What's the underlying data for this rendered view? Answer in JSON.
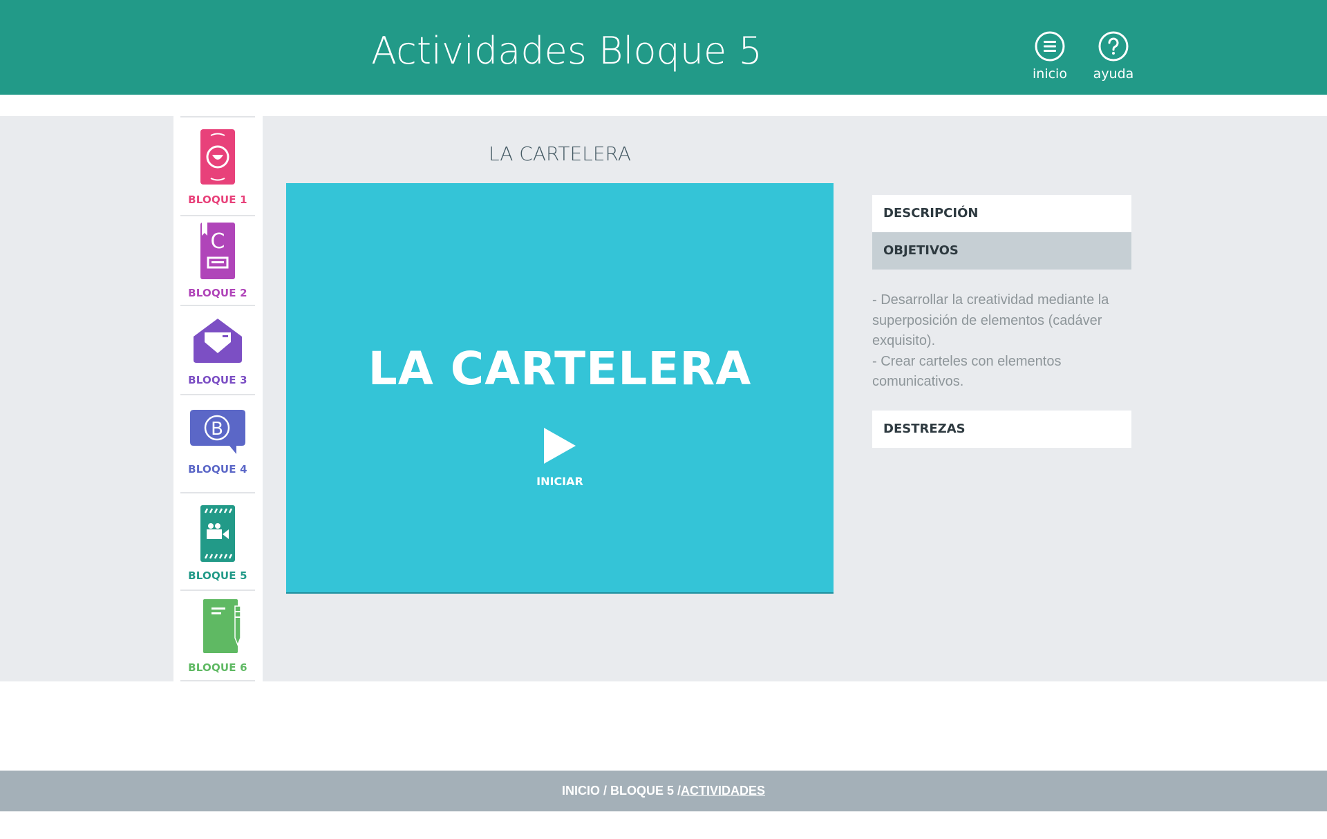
{
  "header": {
    "title": "Actividades Bloque 5",
    "nav": [
      {
        "label": "inicio",
        "icon": "menu-icon"
      },
      {
        "label": "ayuda",
        "icon": "help-icon"
      }
    ],
    "color": "#229a88"
  },
  "sidebar": {
    "items": [
      {
        "label": "BLOQUE 1",
        "color": "#e8417a",
        "icon": "smile-icon"
      },
      {
        "label": "BLOQUE 2",
        "color": "#b045b9",
        "icon": "book-icon"
      },
      {
        "label": "BLOQUE 3",
        "color": "#7c4fc4",
        "icon": "envelope-icon"
      },
      {
        "label": "BLOQUE 4",
        "color": "#5b67c7",
        "icon": "speech-bubble-icon"
      },
      {
        "label": "BLOQUE 5",
        "color": "#229a88",
        "icon": "film-camera-icon"
      },
      {
        "label": "BLOQUE 6",
        "color": "#5fb963",
        "icon": "notebook-pen-icon"
      }
    ]
  },
  "activity": {
    "title": "LA CARTELERA",
    "video_title": "LA CARTELERA",
    "play_label": "INICIAR",
    "video_color": "#34c4d7"
  },
  "panel": {
    "tabs": [
      {
        "label": "DESCRIPCIÓN"
      },
      {
        "label": "OBJETIVOS"
      },
      {
        "label": "DESTREZAS"
      }
    ],
    "objectives": [
      "- Desarrollar la creatividad mediante la superposición de elementos (cadáver exquisito).",
      "- Crear carteles con elementos comunicativos."
    ]
  },
  "breadcrumb": {
    "prefix": "INICIO / BLOQUE 5 /",
    "current": "ACTIVIDADES"
  }
}
